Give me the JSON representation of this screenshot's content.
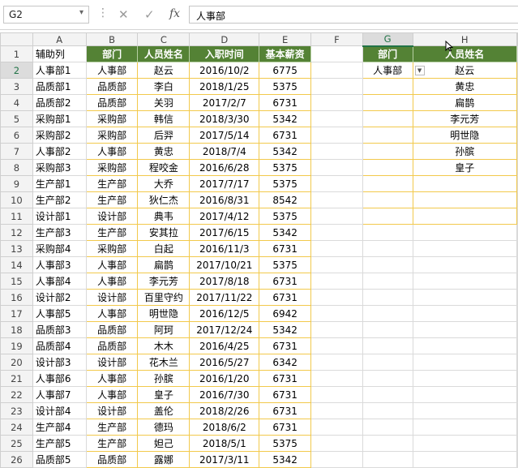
{
  "formula_bar": {
    "name_box": "G2",
    "formula": "人事部",
    "cancel_icon": "✕",
    "enter_icon": "✓",
    "fx_label": "fx"
  },
  "columns": [
    "A",
    "B",
    "C",
    "D",
    "E",
    "F",
    "G",
    "H"
  ],
  "selected_column": "G",
  "row_numbers": [
    "1",
    "2",
    "3",
    "4",
    "5",
    "6",
    "7",
    "8",
    "9",
    "10",
    "11",
    "12",
    "13",
    "14",
    "15",
    "16",
    "17",
    "18",
    "19",
    "20",
    "21",
    "22",
    "23",
    "24",
    "25",
    "26"
  ],
  "table": {
    "headers": [
      "辅助列",
      "部门",
      "人员姓名",
      "入职时间",
      "基本薪资"
    ],
    "rows": [
      [
        "人事部1",
        "人事部",
        "赵云",
        "2016/10/2",
        "6775"
      ],
      [
        "品质部1",
        "品质部",
        "李白",
        "2018/1/25",
        "5375"
      ],
      [
        "品质部2",
        "品质部",
        "关羽",
        "2017/2/7",
        "6731"
      ],
      [
        "采购部1",
        "采购部",
        "韩信",
        "2018/3/30",
        "5342"
      ],
      [
        "采购部2",
        "采购部",
        "后羿",
        "2017/5/14",
        "6731"
      ],
      [
        "人事部2",
        "人事部",
        "黄忠",
        "2018/7/4",
        "5342"
      ],
      [
        "采购部3",
        "采购部",
        "程咬金",
        "2016/6/28",
        "5375"
      ],
      [
        "生产部1",
        "生产部",
        "大乔",
        "2017/7/17",
        "5375"
      ],
      [
        "生产部2",
        "生产部",
        "狄仁杰",
        "2016/8/31",
        "8542"
      ],
      [
        "设计部1",
        "设计部",
        "典韦",
        "2017/4/12",
        "5375"
      ],
      [
        "生产部3",
        "生产部",
        "安其拉",
        "2017/6/15",
        "5342"
      ],
      [
        "采购部4",
        "采购部",
        "白起",
        "2016/11/3",
        "6731"
      ],
      [
        "人事部3",
        "人事部",
        "扁鹊",
        "2017/10/21",
        "5375"
      ],
      [
        "人事部4",
        "人事部",
        "李元芳",
        "2017/8/18",
        "6731"
      ],
      [
        "设计部2",
        "设计部",
        "百里守约",
        "2017/11/22",
        "6731"
      ],
      [
        "人事部5",
        "人事部",
        "明世隐",
        "2016/12/5",
        "6942"
      ],
      [
        "品质部3",
        "品质部",
        "阿珂",
        "2017/12/24",
        "5342"
      ],
      [
        "品质部4",
        "品质部",
        "木木",
        "2016/4/25",
        "6731"
      ],
      [
        "设计部3",
        "设计部",
        "花木兰",
        "2016/5/27",
        "6342"
      ],
      [
        "人事部6",
        "人事部",
        "孙膑",
        "2016/1/20",
        "6731"
      ],
      [
        "人事部7",
        "人事部",
        "皇子",
        "2016/7/30",
        "6731"
      ],
      [
        "设计部4",
        "设计部",
        "盖伦",
        "2018/2/26",
        "6731"
      ],
      [
        "生产部4",
        "生产部",
        "德玛",
        "2018/6/2",
        "6731"
      ],
      [
        "生产部5",
        "生产部",
        "妲己",
        "2018/5/1",
        "5375"
      ],
      [
        "品质部5",
        "品质部",
        "露娜",
        "2017/3/11",
        "5342"
      ]
    ]
  },
  "lookup": {
    "headers": [
      "部门",
      "人员姓名"
    ],
    "department": "人事部",
    "dropdown_icon": "▼",
    "results": [
      "赵云",
      "黄忠",
      "扁鹊",
      "李元芳",
      "明世隐",
      "孙膑",
      "皇子"
    ]
  }
}
